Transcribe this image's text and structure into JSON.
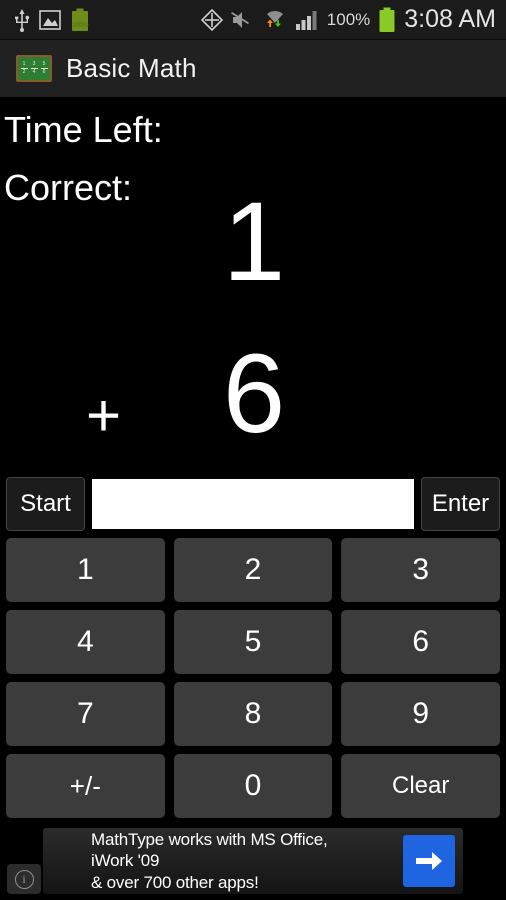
{
  "statusbar": {
    "left_icons": [
      "usb-icon",
      "image-icon",
      "battery-charging-icon"
    ],
    "battery_inline_label": "100%",
    "right_icons": [
      "gps-icon",
      "volume-muted-icon",
      "wifi-transfer-icon",
      "signal-bars-icon"
    ],
    "battery_percent": "100%",
    "clock": "3:08 AM"
  },
  "actionbar": {
    "app_icon": "chalkboard-icon",
    "title": "Basic Math"
  },
  "stats": {
    "time_left_label": "Time Left:",
    "time_left_value": "",
    "correct_label": "Correct:",
    "correct_value": ""
  },
  "problem": {
    "operand_top": "1",
    "operator": "+",
    "operand_bottom": "6"
  },
  "controls": {
    "start_label": "Start",
    "enter_label": "Enter",
    "answer_value": "",
    "answer_placeholder": ""
  },
  "keypad": {
    "keys": [
      "1",
      "2",
      "3",
      "4",
      "5",
      "6",
      "7",
      "8",
      "9",
      "+/-",
      "0",
      "Clear"
    ]
  },
  "ad": {
    "line1": "MathType works with MS Office, iWork '09",
    "line2": "& over 700 other apps!",
    "info_icon": "info-icon",
    "arrow_icon": "arrow-right-icon",
    "arrow_color": "#1f64e0"
  }
}
